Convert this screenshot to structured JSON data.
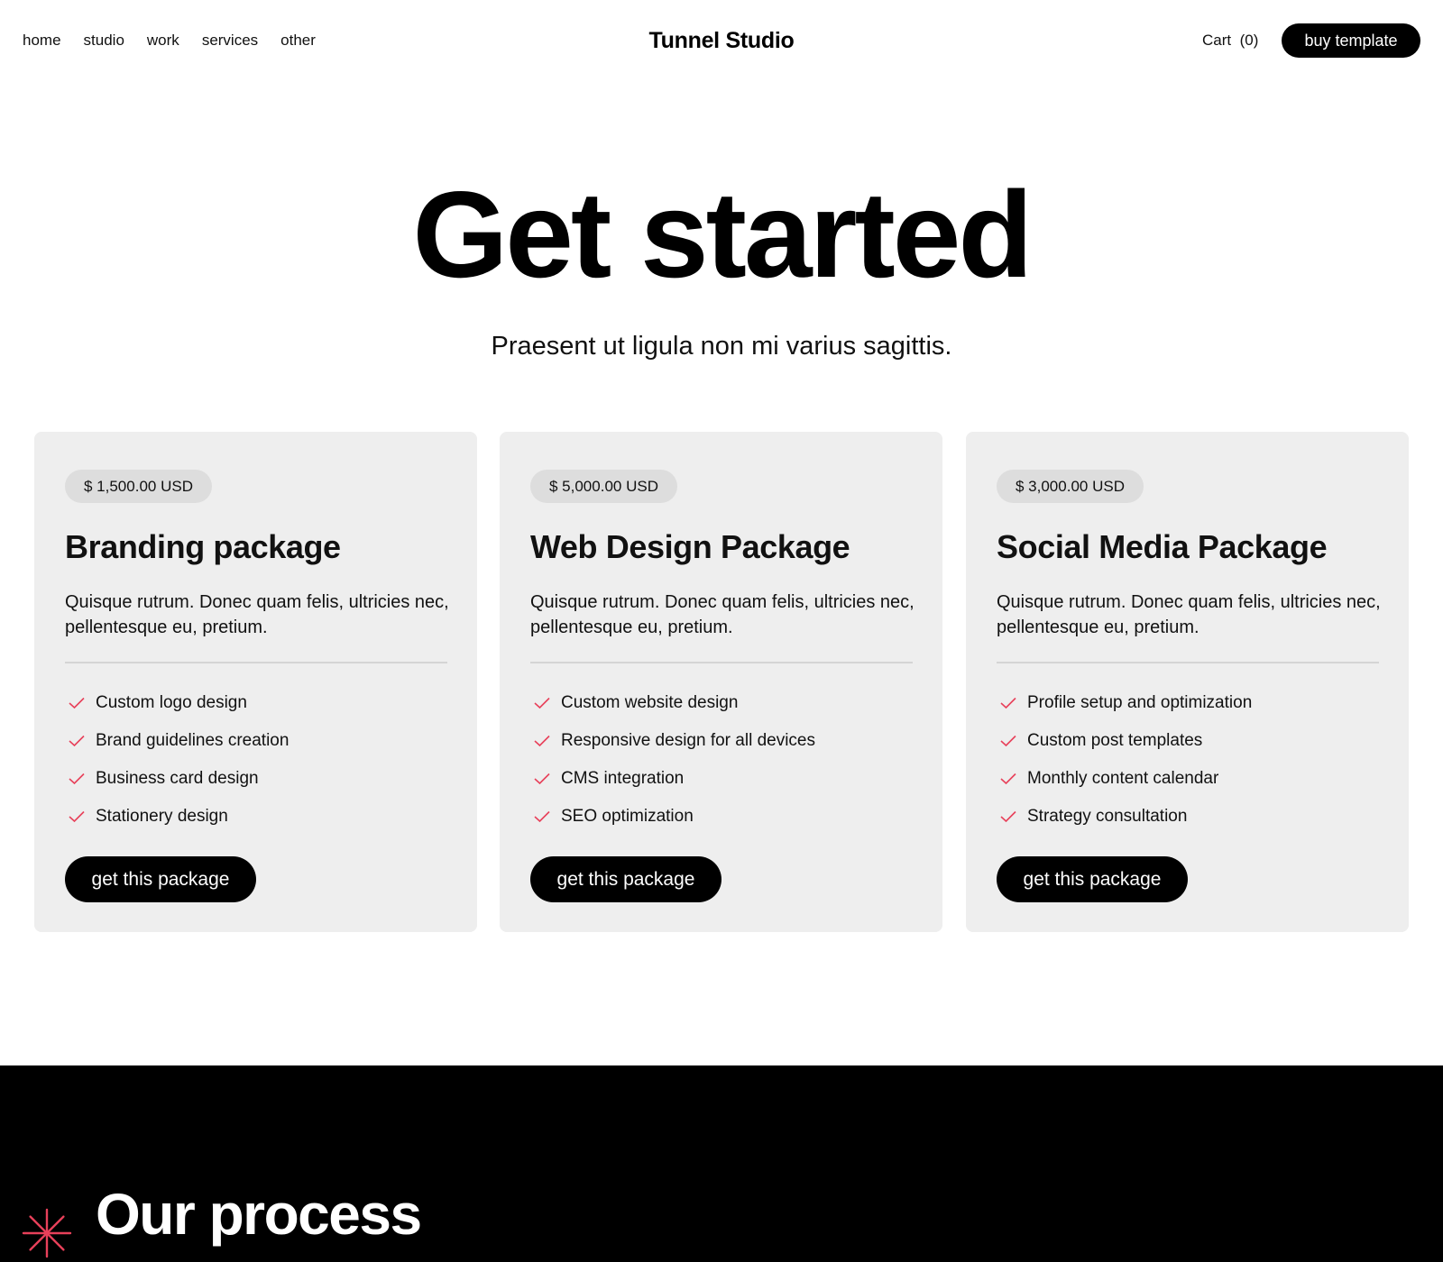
{
  "nav": {
    "items": [
      "home",
      "studio",
      "work",
      "services",
      "other"
    ]
  },
  "brand": {
    "name": "Tunnel Studio"
  },
  "cart": {
    "label": "Cart",
    "count": "(0)"
  },
  "buy_button": {
    "label": "buy template"
  },
  "hero": {
    "title": "Get started",
    "subtitle": "Praesent ut ligula non mi varius sagittis."
  },
  "colors": {
    "accent": "#e8405a",
    "card_bg": "#eeeeee",
    "button_bg": "#000000"
  },
  "packages": [
    {
      "price": "$ 1,500.00 USD",
      "title": "Branding package",
      "description": "Quisque rutrum. Donec quam felis, ultricies nec, pellentesque eu, pretium.",
      "features": [
        "Custom logo design",
        "Brand guidelines creation",
        "Business card design",
        "Stationery design"
      ],
      "cta": "get this package"
    },
    {
      "price": "$ 5,000.00 USD",
      "title": "Web Design Package",
      "description": "Quisque rutrum. Donec quam felis, ultricies nec, pellentesque eu, pretium.",
      "features": [
        "Custom website design",
        "Responsive design for all devices",
        "CMS integration",
        "SEO optimization"
      ],
      "cta": "get this package"
    },
    {
      "price": "$ 3,000.00 USD",
      "title": "Social Media Package",
      "description": "Quisque rutrum. Donec quam felis, ultricies nec, pellentesque eu, pretium.",
      "features": [
        "Profile setup and optimization",
        "Custom post templates",
        "Monthly content calendar",
        "Strategy consultation"
      ],
      "cta": "get this package"
    }
  ],
  "process": {
    "title": "Our process",
    "icon": "asterisk-icon"
  }
}
